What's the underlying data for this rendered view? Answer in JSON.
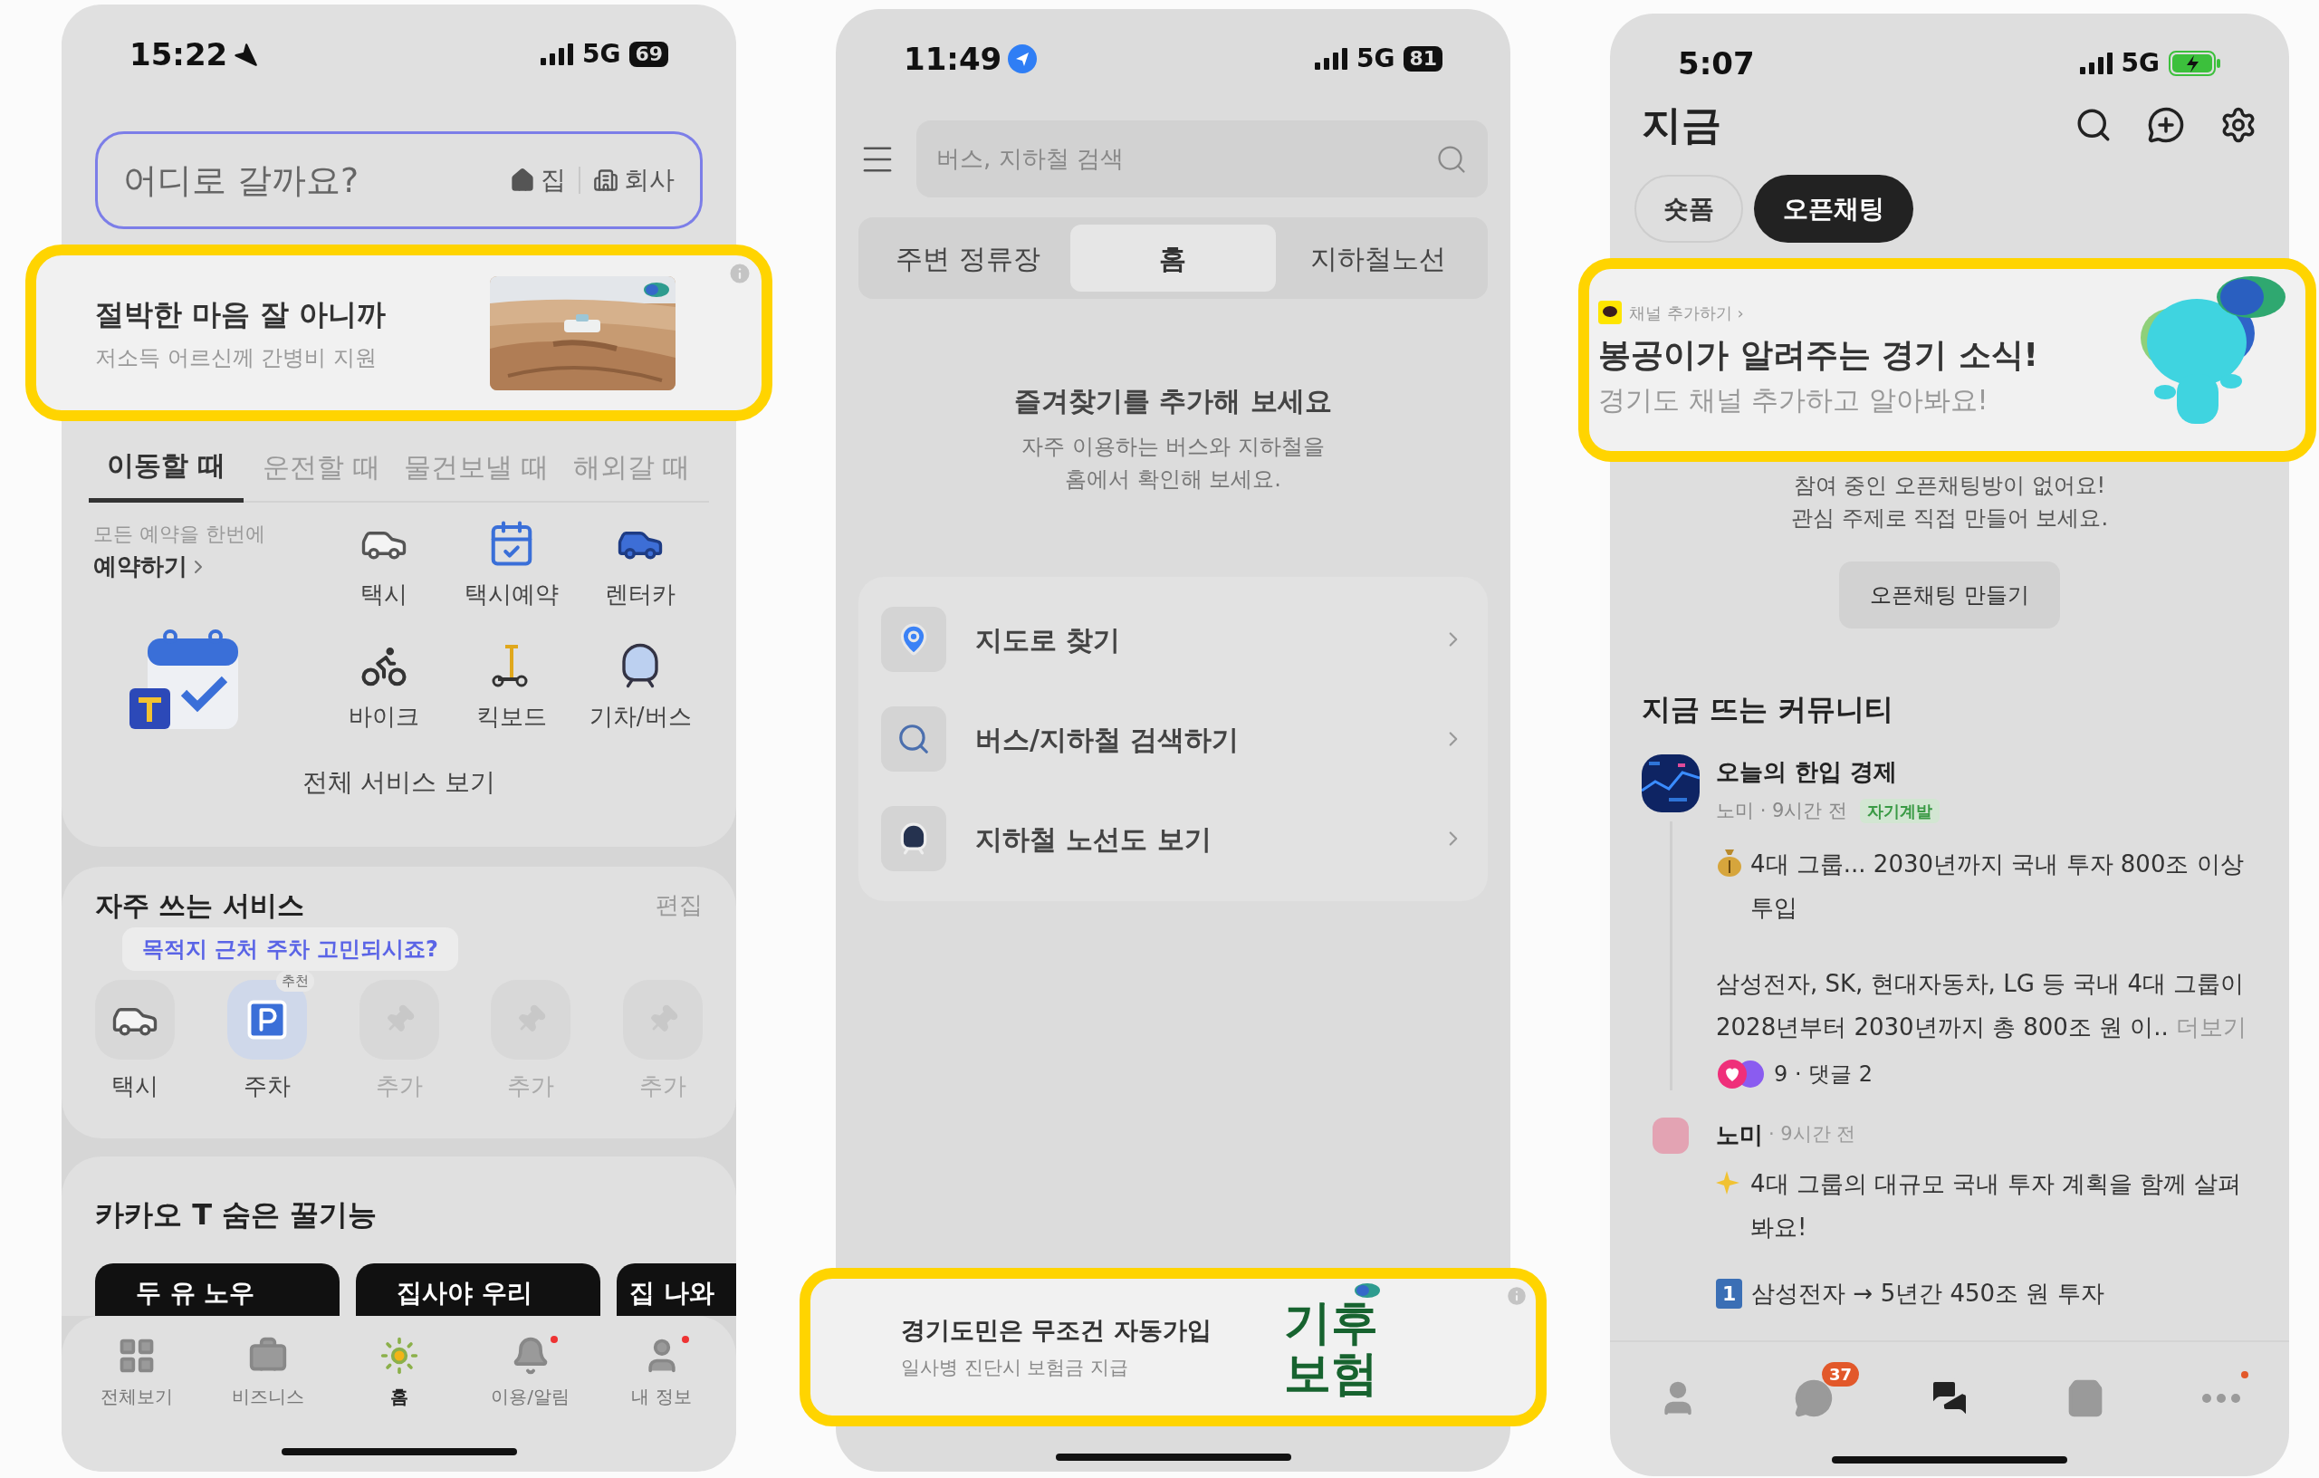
{
  "taxi_app": {
    "status_bar": {
      "time": "15:22",
      "network": "5G",
      "battery": "69",
      "charging": false
    },
    "search": {
      "placeholder": "어디로 갈까요?",
      "shortcuts": [
        "집",
        "회사"
      ]
    },
    "ad": {
      "title": "절박한 마음 잘 아니까",
      "subtitle": "저소득 어르신께 간병비 지원"
    },
    "tabs": [
      {
        "label": "이동할 때",
        "selected": true
      },
      {
        "label": "운전할 때",
        "selected": false
      },
      {
        "label": "물건보낼 때",
        "selected": false
      },
      {
        "label": "해외갈 때",
        "selected": false
      }
    ],
    "reserve": {
      "caption": "모든 예약을 한번에",
      "link": "예약하기"
    },
    "services": [
      {
        "label": "택시",
        "kind": "taxi"
      },
      {
        "label": "택시예약",
        "kind": "taxi_reservation"
      },
      {
        "label": "렌터카",
        "kind": "rental_car"
      },
      {
        "label": "바이크",
        "kind": "bike"
      },
      {
        "label": "킥보드",
        "kind": "kickboard"
      },
      {
        "label": "기차/버스",
        "kind": "train_bus"
      }
    ],
    "all_services": "전체 서비스 보기",
    "favorites": {
      "title": "자주 쓰는 서비스",
      "edit": "편집",
      "tooltip": "목적지 근처 주차 고민되시죠?",
      "items": [
        {
          "label": "택시",
          "kind": "taxi"
        },
        {
          "label": "주차",
          "kind": "parking",
          "badge": "추천"
        },
        {
          "label": "추가",
          "kind": "empty"
        },
        {
          "label": "추가",
          "kind": "empty"
        },
        {
          "label": "추가",
          "kind": "empty"
        }
      ]
    },
    "tips": {
      "title": "카카오 T 숨은 꿀기능",
      "cards": [
        "두 유 노우",
        "집사야 우리",
        "집 나와"
      ]
    },
    "tab_bar": [
      {
        "label": "전체보기",
        "selected": false,
        "dot": false
      },
      {
        "label": "비즈니스",
        "selected": false,
        "dot": false
      },
      {
        "label": "홈",
        "selected": true,
        "dot": false
      },
      {
        "label": "이용/알림",
        "selected": false,
        "dot": true
      },
      {
        "label": "내 정보",
        "selected": false,
        "dot": true
      }
    ]
  },
  "transit_app": {
    "status_bar": {
      "time": "11:49",
      "network": "5G",
      "battery": "81",
      "charging": false
    },
    "search": {
      "placeholder": "버스, 지하철 검색"
    },
    "tabs": [
      {
        "label": "주변 정류장",
        "selected": false
      },
      {
        "label": "홈",
        "selected": true
      },
      {
        "label": "지하철노선",
        "selected": false
      }
    ],
    "empty": {
      "title": "즐겨찾기를 추가해 보세요",
      "body": "자주 이용하는 버스와 지하철을\n홈에서 확인해 보세요."
    },
    "menu": [
      {
        "label": "지도로 찾기",
        "kind": "map"
      },
      {
        "label": "버스/지하철 검색하기",
        "kind": "search"
      },
      {
        "label": "지하철 노선도 보기",
        "kind": "subway"
      }
    ],
    "ad": {
      "title": "경기도민은 무조건 자동가입",
      "subtitle": "일사병 진단시 보험금 지급",
      "graphic_text": "기후\n보험"
    }
  },
  "talk_app": {
    "status_bar": {
      "time": "5:07",
      "network": "5G",
      "charging": true
    },
    "title": "지금",
    "chips": [
      {
        "label": "숏폼",
        "selected": false
      },
      {
        "label": "오픈채팅",
        "selected": true
      }
    ],
    "ad": {
      "channel": "채널 추가하기 ›",
      "title": "봉공이가 알려주는 경기 소식!",
      "subtitle": "경기도 채널 추가하고 알아봐요!"
    },
    "empty": {
      "body": "참여 중인 오픈채팅방이 없어요!\n관심 주제로 직접 만들어 보세요.",
      "button": "오픈채팅 만들기"
    },
    "community_title": "지금 뜨는 커뮤니티",
    "post": {
      "name": "오늘의 한입 경제",
      "meta": "노미 · 9시간 전",
      "tag": "자기계발",
      "headline": "4대 그룹... 2030년까지 국내 투자 800조 이상 투입",
      "body": "삼성전자, SK, 현대자동차, LG 등 국내 4대 그룹이 2028년부터 2030년까지 총 800조 원 이..",
      "more": "더보기",
      "reactions": "9 · 댓글 2"
    },
    "reply": {
      "name": "노미",
      "time": "· 9시간 전",
      "text": "4대 그룹의 대규모 국내 투자 계획을 함께 살펴봐요!",
      "number": "1",
      "line": "삼성전자 → 5년간 450조 원 투자"
    },
    "tab_bar": [
      {
        "selected": false,
        "dot": false
      },
      {
        "selected": false,
        "dot": false,
        "badge": "37"
      },
      {
        "selected": true,
        "dot": false
      },
      {
        "selected": false,
        "dot": false
      },
      {
        "selected": false,
        "dot": true
      }
    ]
  }
}
